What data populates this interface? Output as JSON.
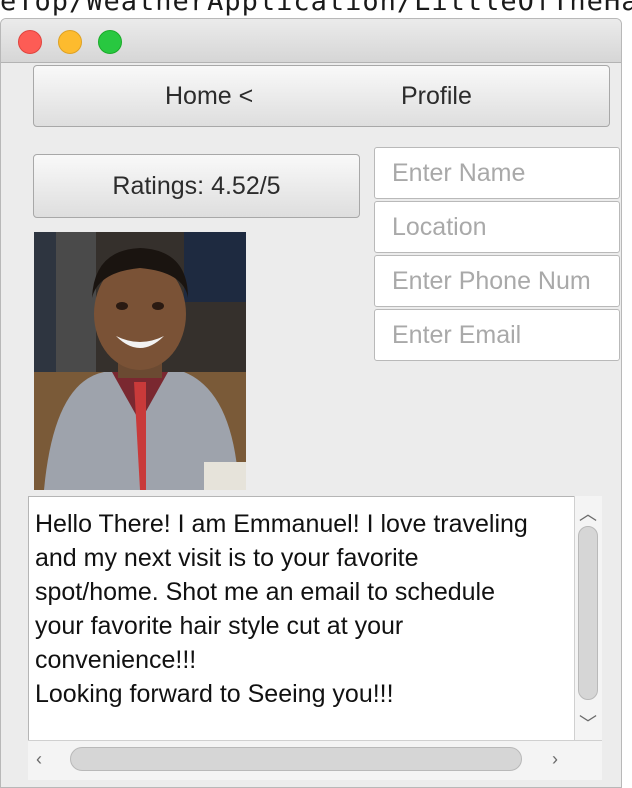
{
  "background": {
    "path_text": "eTop/WeatherApplication/LittleOfTheHat/J"
  },
  "window": {
    "traffic_lights": {
      "close": "#fd5c55",
      "minimize": "#fdbb2e",
      "zoom": "#28c840"
    }
  },
  "nav": {
    "home_label": "Home <",
    "profile_label": "Profile"
  },
  "ratings": {
    "label": "Ratings: 4.52/5"
  },
  "form": {
    "name_placeholder": "Enter Name",
    "location_placeholder": "Location",
    "phone_placeholder": "Enter Phone Num",
    "email_placeholder": "Enter Email"
  },
  "profile_photo": {
    "subject": "smiling man in grey sweater with lanyard"
  },
  "bio": {
    "text": "Hello There! I am Emmanuel! I love traveling\nand my next visit is to your favorite\nspot/home. Shot me an email to schedule\nyour favorite hair style cut at your\nconvenience!!!\nLooking forward to Seeing you!!!"
  },
  "icons": {
    "scroll_up": "chevron-up-icon",
    "scroll_down": "chevron-down-icon",
    "scroll_left": "chevron-left-icon",
    "scroll_right": "chevron-right-icon"
  }
}
